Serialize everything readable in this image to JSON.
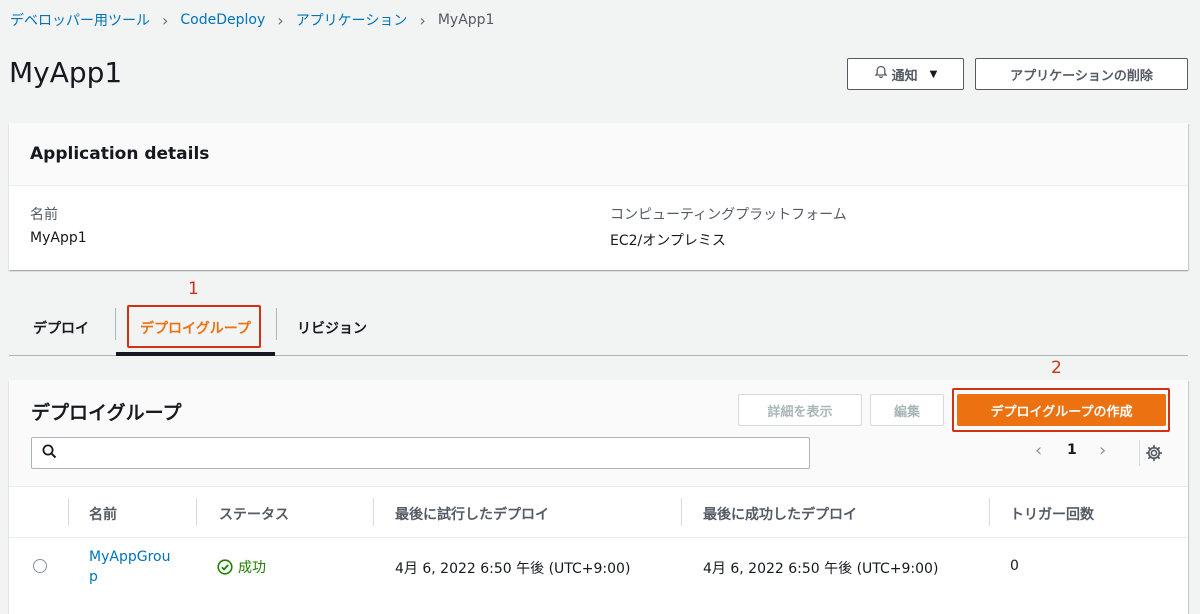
{
  "breadcrumb": {
    "items": [
      "デベロッパー用ツール",
      "CodeDeploy",
      "アプリケーション"
    ],
    "current": "MyApp1"
  },
  "page": {
    "title": "MyApp1",
    "notify_label": "通知",
    "delete_label": "アプリケーションの削除"
  },
  "details": {
    "title": "Application details",
    "name_label": "名前",
    "name_value": "MyApp1",
    "platform_label": "コンピューティングプラットフォーム",
    "platform_value": "EC2/オンプレミス"
  },
  "annotations": [
    "1",
    "2"
  ],
  "tabs": [
    {
      "label": "デプロイ"
    },
    {
      "label": "デプロイグループ"
    },
    {
      "label": "リビジョン"
    }
  ],
  "deployment_groups": {
    "title": "デプロイグループ",
    "view_details_label": "詳細を表示",
    "edit_label": "編集",
    "create_label": "デプロイグループの作成",
    "search_placeholder": "",
    "page_number": "1",
    "columns": [
      "名前",
      "ステータス",
      "最後に試行したデプロイ",
      "最後に成功したデプロイ",
      "トリガー回数"
    ],
    "rows": [
      {
        "name_line1": "MyAppGrou",
        "name_line2": "p",
        "status": "成功",
        "last_attempted": "4月 6, 2022 6:50 午後 (UTC+9:00)",
        "last_succeeded": "4月 6, 2022 6:50 午後 (UTC+9:00)",
        "trigger_count": "0"
      }
    ]
  },
  "colors": {
    "link": "#0073bb",
    "accent": "#ec7211",
    "annotation": "#d13212",
    "success": "#1d8102"
  }
}
